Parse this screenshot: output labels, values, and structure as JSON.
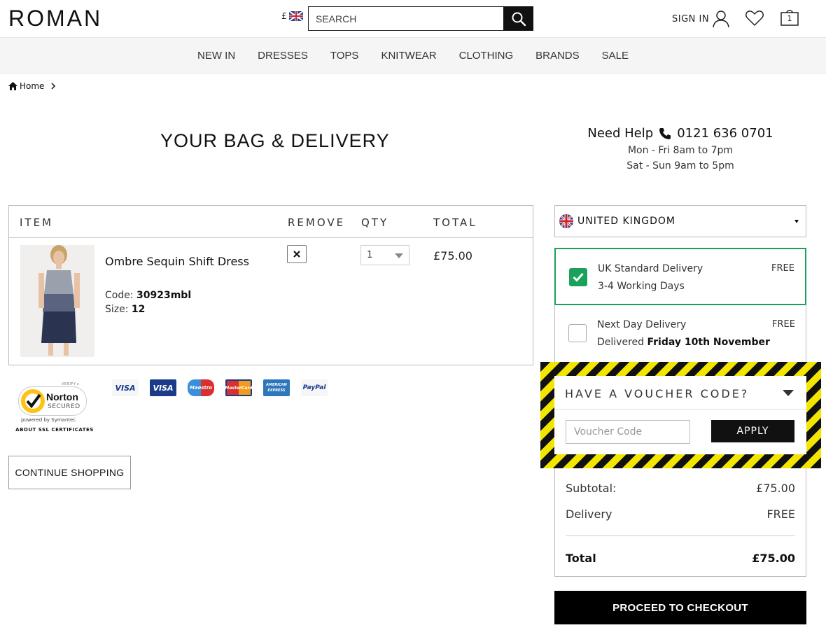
{
  "header": {
    "logo": "ROMAN",
    "currency": "£",
    "search_placeholder": "SEARCH",
    "signin_label": "SIGN IN",
    "bag_count": "1"
  },
  "nav": {
    "items": [
      "NEW IN",
      "DRESSES",
      "TOPS",
      "KNITWEAR",
      "CLOTHING",
      "BRANDS",
      "SALE"
    ]
  },
  "breadcrumb": {
    "home": "Home"
  },
  "page": {
    "title": "YOUR BAG & DELIVERY"
  },
  "help": {
    "label": "Need Help",
    "phone": "0121 636 0701",
    "hours_weekday": "Mon - Fri 8am to 7pm",
    "hours_weekend": "Sat - Sun 9am to 5pm"
  },
  "bag": {
    "headers": {
      "item": "ITEM",
      "remove": "REMOVE",
      "qty": "QTY",
      "total": "TOTAL"
    },
    "item": {
      "name": "Ombre Sequin Shift Dress",
      "code_label": "Code:",
      "code": "30923mbl",
      "size_label": "Size:",
      "size": "12",
      "qty": "1",
      "price": "£75.00"
    }
  },
  "security": {
    "norton_verify": "VERIFY ▸",
    "norton_brand": "Norton",
    "norton_secured": "SECURED",
    "norton_powered": "powered by Symantec",
    "ssl_link": "ABOUT SSL CERTIFICATES"
  },
  "payment_cards": [
    "VISA",
    "VISA",
    "Maestro",
    "MasterCard",
    "AMERICAN EXPRESS",
    "PayPal"
  ],
  "continue_label": "CONTINUE SHOPPING",
  "delivery": {
    "country": "UNITED KINGDOM",
    "options": [
      {
        "title": "UK Standard Delivery",
        "sub": "3-4 Working Days",
        "price": "FREE"
      },
      {
        "title": "Next Day Delivery",
        "sub_prefix": "Delivered",
        "sub_bold": "Friday 10th November",
        "price": "FREE"
      }
    ]
  },
  "voucher": {
    "title": "HAVE A VOUCHER CODE?",
    "placeholder": "Voucher Code",
    "apply_label": "APPLY"
  },
  "summary": {
    "subtotal_label": "Subtotal:",
    "subtotal": "£75.00",
    "delivery_label": "Delivery",
    "delivery": "FREE",
    "total_label": "Total",
    "total": "£75.00"
  },
  "checkout_label": "PROCEED TO CHECKOUT",
  "colors": {
    "accent_green": "#1aa15b",
    "primary_black": "#111111",
    "highlight_yellow": "#f2e500"
  }
}
